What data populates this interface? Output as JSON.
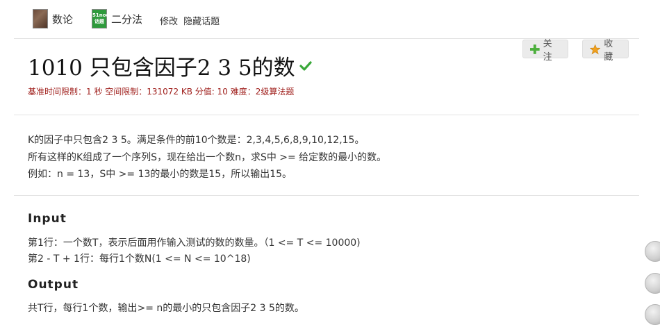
{
  "tags": [
    {
      "label": "数论",
      "icon": "book-cover-icon"
    },
    {
      "label": "二分法",
      "icon": "topic-badge-icon",
      "badge_text": [
        "51nod",
        "话题"
      ]
    }
  ],
  "tag_actions": {
    "edit": "修改",
    "hide": "隐藏话题"
  },
  "problem": {
    "title": "1010 只包含因子2 3 5的数",
    "meta": "基准时间限制：1 秒 空间限制：131072 KB 分值: 10 难度：2级算法题",
    "follow_label": "关注",
    "favorite_label": "收藏",
    "description": [
      "K的因子中只包含2 3 5。满足条件的前10个数是：2,3,4,5,6,8,9,10,12,15。",
      "所有这样的K组成了一个序列S，现在给出一个数n，求S中 >= 给定数的最小的数。",
      "例如：n = 13，S中 >= 13的最小的数是15，所以输出15。"
    ],
    "input_title": "Input",
    "input_lines": [
      "第1行：一个数T，表示后面用作输入测试的数的数量。（1 <= T <= 10000)",
      "第2 - T + 1行：每行1个数N(1 <= N <= 10^18)"
    ],
    "output_title": "Output",
    "output_lines": [
      "共T行，每行1个数，输出>= n的最小的只包含因子2 3 5的数。"
    ]
  },
  "colors": {
    "accent_red": "#a0201d",
    "check_green": "#3aa83a",
    "plus_green": "#4caf3c",
    "star_orange": "#f0a020"
  }
}
